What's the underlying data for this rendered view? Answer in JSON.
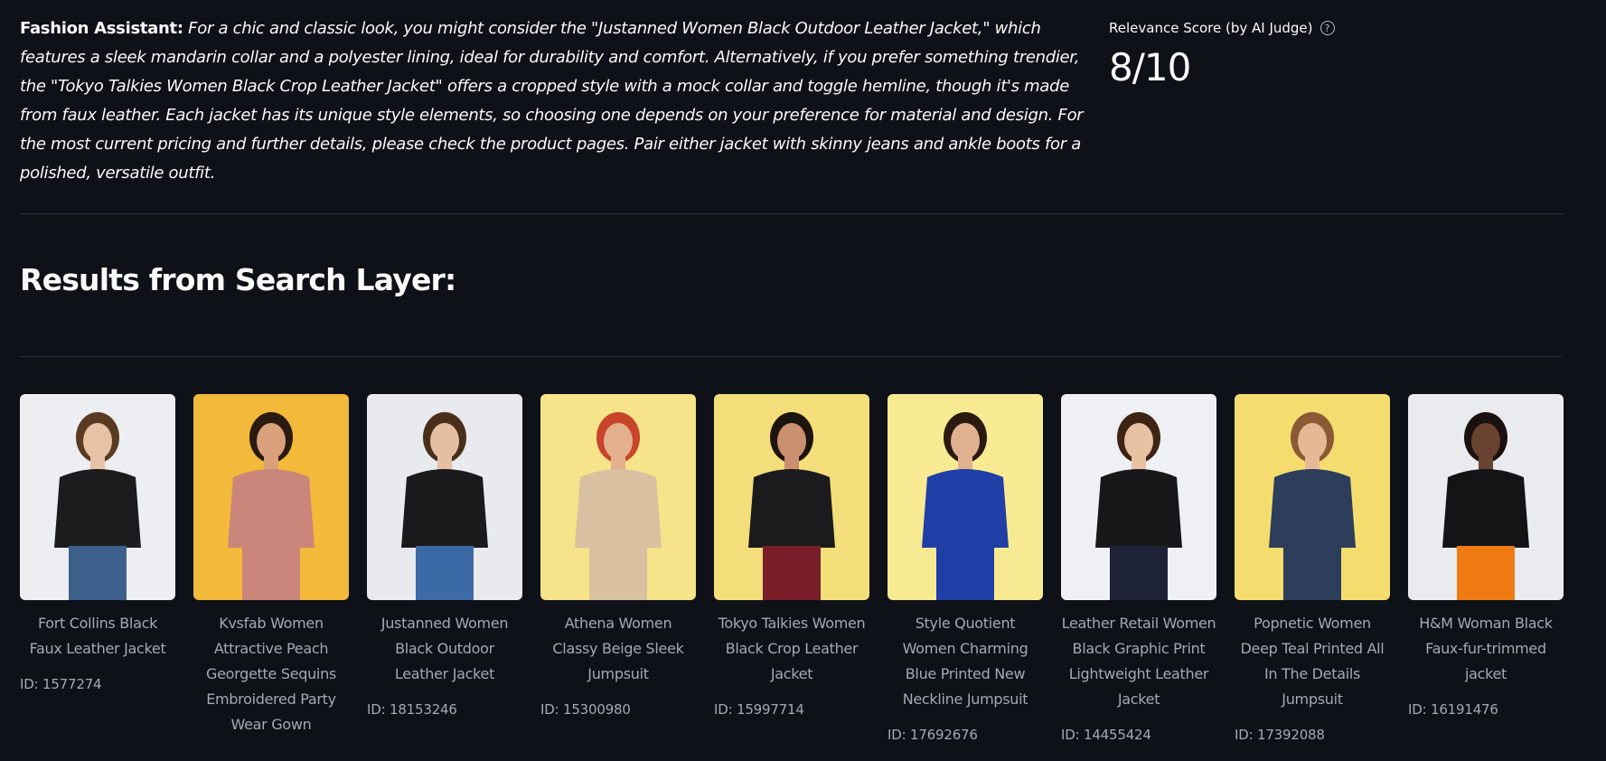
{
  "assistant": {
    "label": "Fashion Assistant:",
    "message": "For a chic and classic look, you might consider the \"Justanned Women Black Outdoor Leather Jacket,\" which features a sleek mandarin collar and a polyester lining, ideal for durability and comfort. Alternatively, if you prefer something trendier, the \"Tokyo Talkies Women Black Crop Leather Jacket\" offers a cropped style with a mock collar and toggle hemline, though it's made from faux leather. Each jacket has its unique style elements, so choosing one depends on your preference for material and design. For the most current pricing and further details, please check the product pages. Pair either jacket with skinny jeans and ankle boots for a polished, versatile outfit."
  },
  "score": {
    "label": "Relevance Score (by AI Judge)",
    "help_icon": "question-circle-icon",
    "value": "8/10"
  },
  "results": {
    "title": "Results from Search Layer:",
    "products": [
      {
        "name": "Fort Collins Black Faux Leather Jacket",
        "id": "ID: 1577274",
        "bg": "#eceef2",
        "outfit": "#1c1c1e",
        "bottom": "#3d5f8c",
        "hair": "#5a3b22",
        "skin": "#e8c2a4"
      },
      {
        "name": "Kvsfab Women Attractive Peach Georgette Sequins Embroidered Party Wear Gown",
        "id": "",
        "bg": "#f2b93a",
        "outfit": "#c9857a",
        "bottom": "#c9857a",
        "hair": "#2a1a10",
        "skin": "#d9a07c"
      },
      {
        "name": "Justanned Women Black Outdoor Leather Jacket",
        "id": "ID: 18153246",
        "bg": "#e8eaee",
        "outfit": "#1a1a1c",
        "bottom": "#3b6aa6",
        "hair": "#4a2f1a",
        "skin": "#e6bfa2"
      },
      {
        "name": "Athena Women Classy Beige Sleek Jumpsuit",
        "id": "ID: 15300980",
        "bg": "#f6e38a",
        "outfit": "#d8c0a0",
        "bottom": "#d8c0a0",
        "hair": "#c8442a",
        "skin": "#e3b08e"
      },
      {
        "name": "Tokyo Talkies Women Black Crop Leather Jacket",
        "id": "ID: 15997714",
        "bg": "#f4de7a",
        "outfit": "#1b1b1d",
        "bottom": "#7a1e2a",
        "hair": "#1e140e",
        "skin": "#c98f6e"
      },
      {
        "name": "Style Quotient Women Charming Blue Printed New Neckline Jumpsuit",
        "id": "ID: 17692676",
        "bg": "#f8ea92",
        "outfit": "#1f3fa6",
        "bottom": "#1f3fa6",
        "hair": "#2a1a10",
        "skin": "#e0b090"
      },
      {
        "name": "Leather Retail Women Black Graphic Print Lightweight Leather Jacket",
        "id": "ID: 14455424",
        "bg": "#eef0f3",
        "outfit": "#18181a",
        "bottom": "#1e2236",
        "hair": "#3e2414",
        "skin": "#e8c0a2"
      },
      {
        "name": "Popnetic Women Deep Teal Printed All In The Details Jumpsuit",
        "id": "ID: 17392088",
        "bg": "#f5dc6e",
        "outfit": "#2c3e5c",
        "bottom": "#2c3e5c",
        "hair": "#8a5a34",
        "skin": "#e7b896"
      },
      {
        "name": "H&M Woman Black Faux-fur-trimmed jacket",
        "id": "ID: 16191476",
        "bg": "#e9ebef",
        "outfit": "#141416",
        "bottom": "#f07a12",
        "hair": "#1a1210",
        "skin": "#6a4330"
      }
    ]
  }
}
